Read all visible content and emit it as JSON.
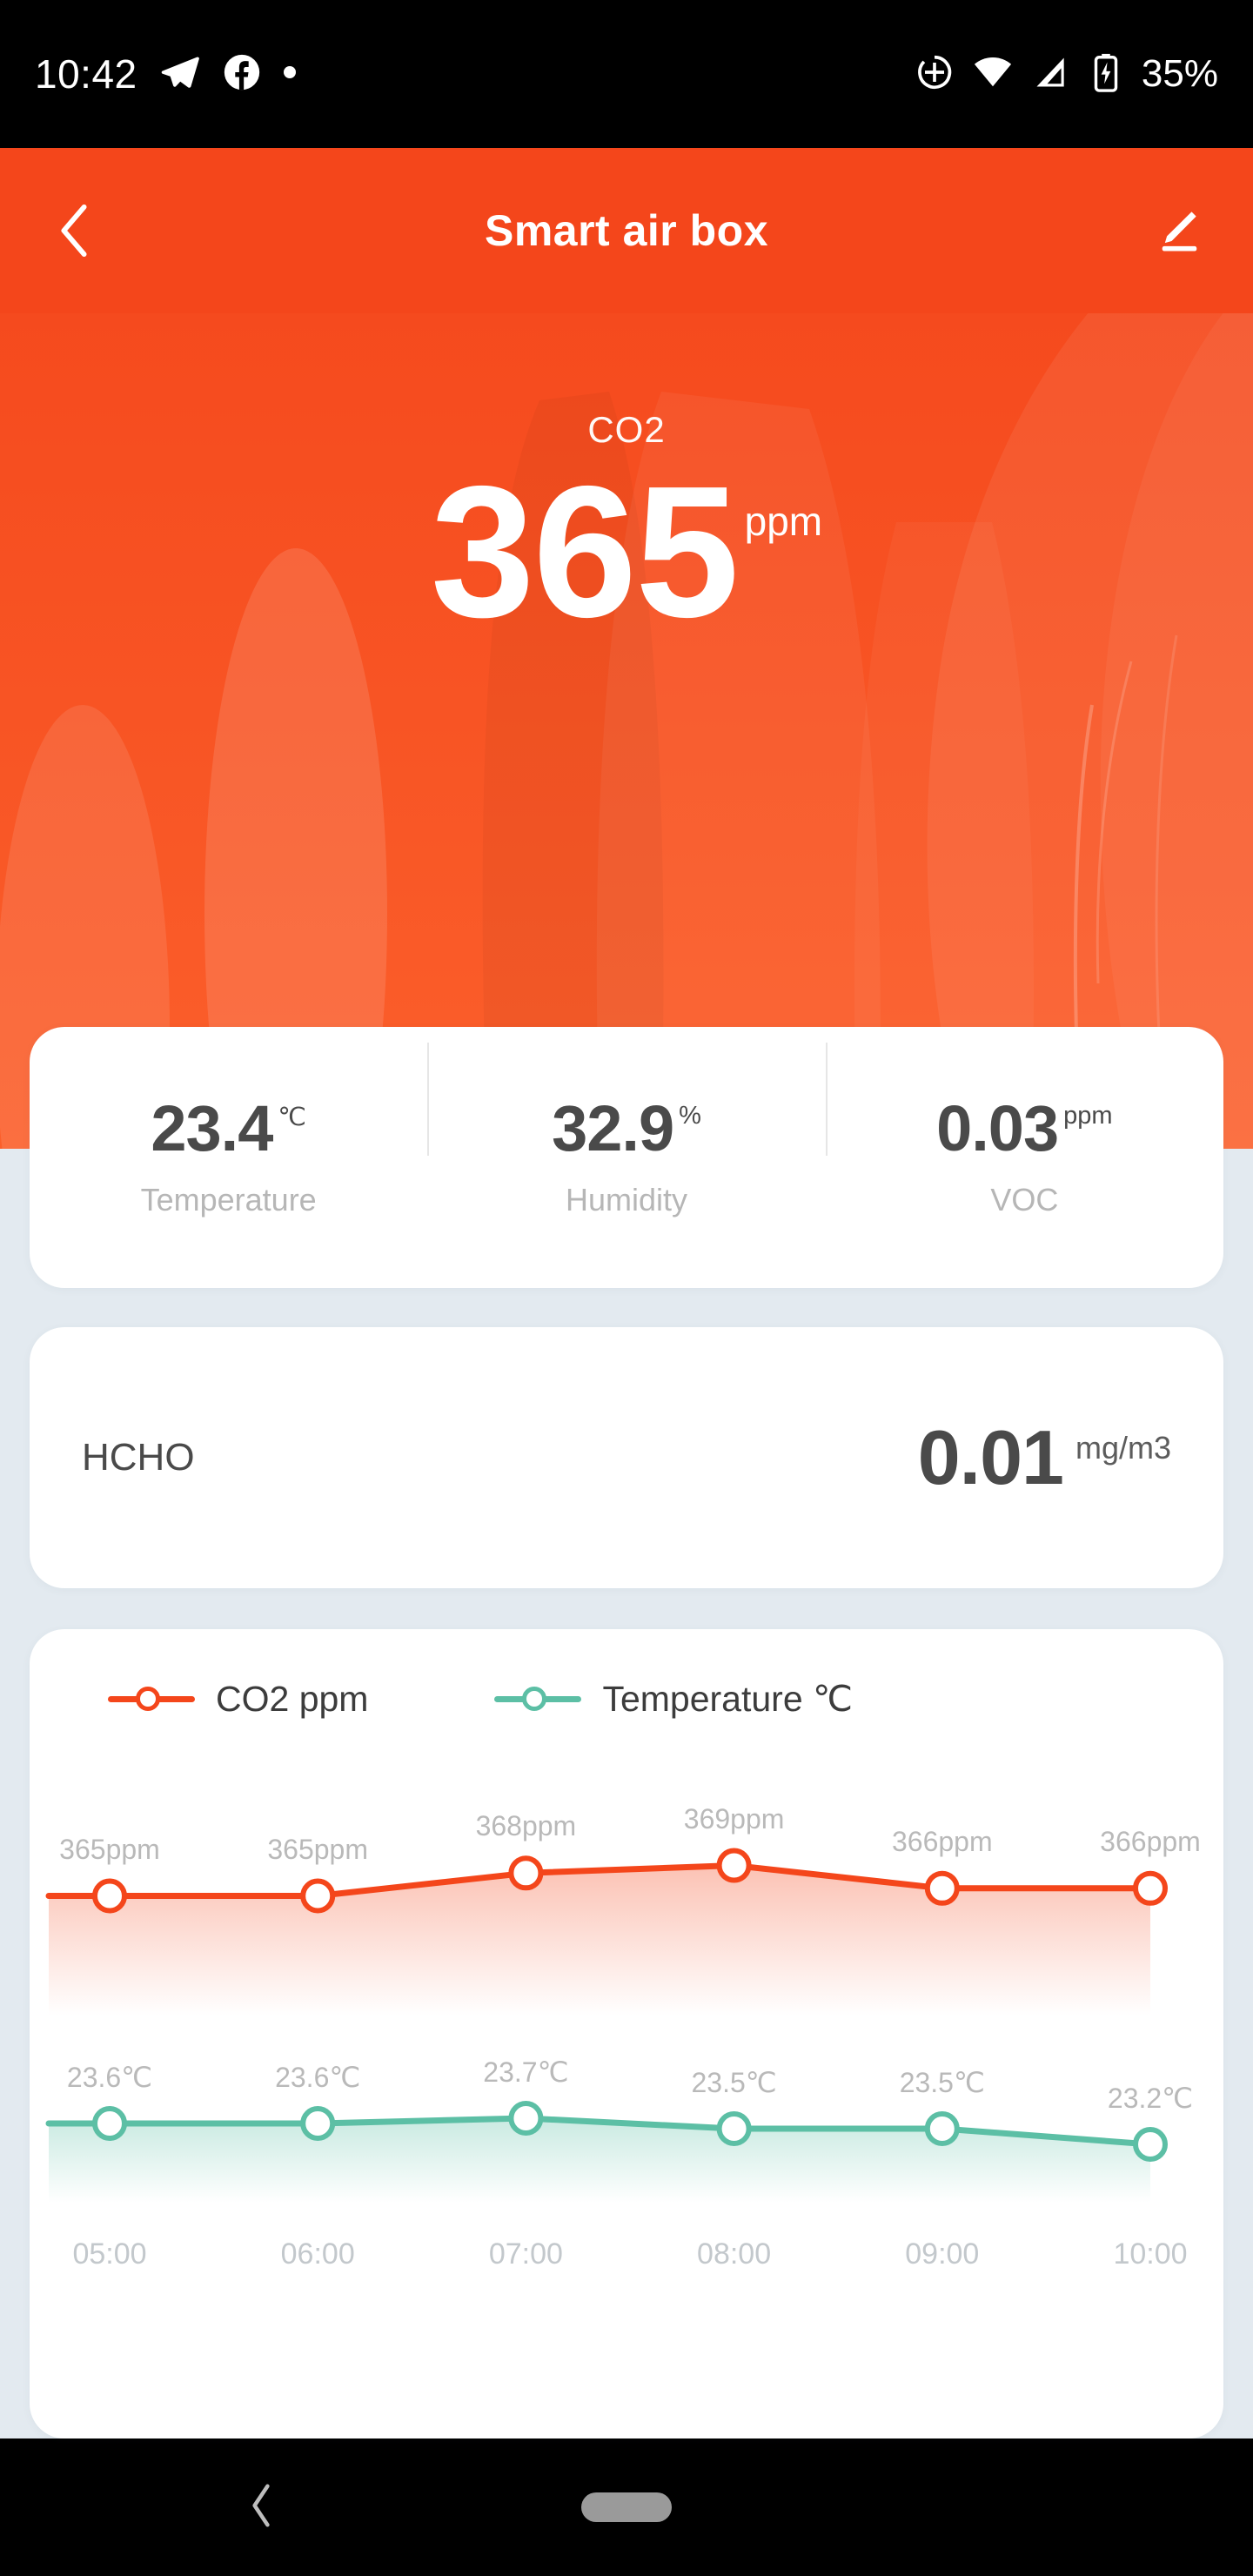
{
  "status_bar": {
    "time": "10:42",
    "battery_percent": "35%",
    "left_icons": [
      "telegram-icon",
      "facebook-icon",
      "dot-icon"
    ],
    "right_icons": [
      "data-saver-icon",
      "wifi-icon",
      "cellular-signal-icon",
      "battery-charging-icon"
    ]
  },
  "app_bar": {
    "title": "Smart air box",
    "back_icon": "back-chevron-icon",
    "edit_icon": "pencil-edit-icon"
  },
  "hero": {
    "label": "CO2",
    "value": "365",
    "unit": "ppm",
    "background_color": "#f4461b"
  },
  "metrics": [
    {
      "value": "23.4",
      "unit": "℃",
      "name": "Temperature"
    },
    {
      "value": "32.9",
      "unit": "%",
      "name": "Humidity"
    },
    {
      "value": "0.03",
      "unit": "ppm",
      "name": "VOC"
    }
  ],
  "hcho": {
    "name": "HCHO",
    "value": "0.01",
    "unit": "mg/m3"
  },
  "chart_data": {
    "type": "line",
    "title": "",
    "xlabel": "",
    "ylabel": "",
    "grid": false,
    "legend_position": "top-left",
    "x": [
      "05:00",
      "06:00",
      "07:00",
      "08:00",
      "09:00",
      "10:00"
    ],
    "series": [
      {
        "name": "CO2 ppm",
        "color": "#f4461b",
        "unit": "ppm",
        "values": [
          365,
          365,
          368,
          369,
          366,
          366
        ],
        "labels": [
          "365ppm",
          "365ppm",
          "368ppm",
          "369ppm",
          "366ppm",
          "366ppm"
        ],
        "ylim": [
          363,
          371
        ]
      },
      {
        "name": "Temperature ℃",
        "color": "#5cbfa5",
        "unit": "℃",
        "values": [
          23.6,
          23.6,
          23.7,
          23.5,
          23.5,
          23.2
        ],
        "labels": [
          "23.6℃",
          "23.6℃",
          "23.7℃",
          "23.5℃",
          "23.5℃",
          "23.2℃"
        ],
        "ylim": [
          23.0,
          24.0
        ]
      }
    ]
  },
  "nav_bar": {
    "back_icon": "nav-back-icon",
    "home_pill": "nav-home-pill"
  }
}
